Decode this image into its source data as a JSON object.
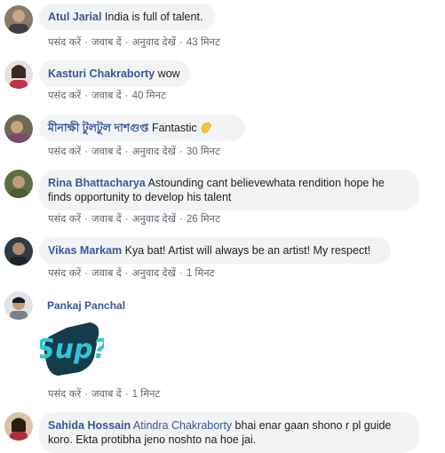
{
  "actions": {
    "like": "पसंद करें",
    "reply": "जवाब दें",
    "translate": "अनुवाद देखें",
    "dot": "·"
  },
  "comments": [
    {
      "name": "Atul Jarial",
      "text": "India is full of talent.",
      "time": "43 मिनट"
    },
    {
      "name": "Kasturi Chakraborty",
      "text": "wow",
      "time": "40 मिनट"
    },
    {
      "name": "মীনাক্ষী টুলটুল দাশগুপ্ত",
      "text": "Fantastic",
      "emoji": "clapping-hands-icon",
      "time": "30 मिनट"
    },
    {
      "name": "Rina Bhattacharya",
      "text": "Astounding cant believewhata rendition hope he finds opportunity to develop his talent",
      "line1": "Astounding cant believewhata rendition hope he",
      "line2": "finds opportunity to develop his talent",
      "time": "26 मिनट"
    },
    {
      "name": "Vikas Markam",
      "text": "Kya bat! Artist will always be an artist! My respect!",
      "time": "1 मिनट"
    },
    {
      "name": "Pankaj Panchal",
      "sticker_text": "Sup?",
      "time": "1 मिनट"
    },
    {
      "name": "Sahida Hossain",
      "mention": "Atindra Chakraborty",
      "line1": "bhai enar gaan shono r pl guide",
      "line2": "koro. Ekta protibha jeno noshto na hoe jai."
    }
  ],
  "colors": {
    "name": "#385898",
    "bubble": "#f2f3f5",
    "meta": "#606770",
    "sticker": "#1fb5c9"
  }
}
